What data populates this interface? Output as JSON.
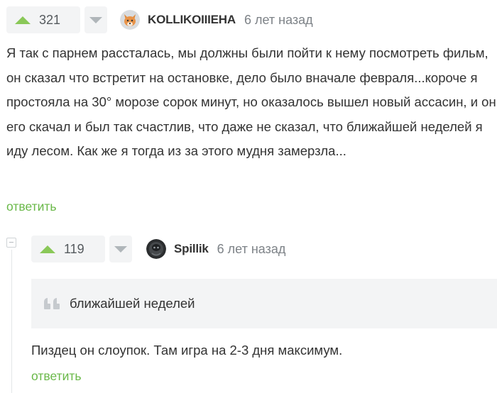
{
  "colors": {
    "upvote": "#8ac858",
    "downvote": "#b0b6ba",
    "reply_link": "#69b848",
    "vote_bg": "#f3f4f5",
    "quote_bg": "#f3f4f5"
  },
  "comments": [
    {
      "rating": "321",
      "username": "KOLLIKOIIIEHA",
      "time": "6 лет назад",
      "avatar_icon": "fox-avatar",
      "body": "Я так с парнем рассталась, мы должны были пойти к нему посмотреть фильм, он сказал что встретит на остановке, дело было вначале февраля...короче я простояла на 30° морозе сорок минут, но оказалось вышел новый ассасин, и он его скачал и был так счастлив, что даже не сказал, что ближайшей неделей я иду лесом. Как же я тогда из за этого мудня замерзла...",
      "reply": "ответить"
    },
    {
      "rating": "119",
      "username": "Spillik",
      "time": "6 лет назад",
      "avatar_icon": "dark-avatar",
      "quote": "ближайшей неделей",
      "body": "Пиздец он слоупок. Там игра на 2-3 дня максимум.",
      "reply": "ответить"
    }
  ]
}
